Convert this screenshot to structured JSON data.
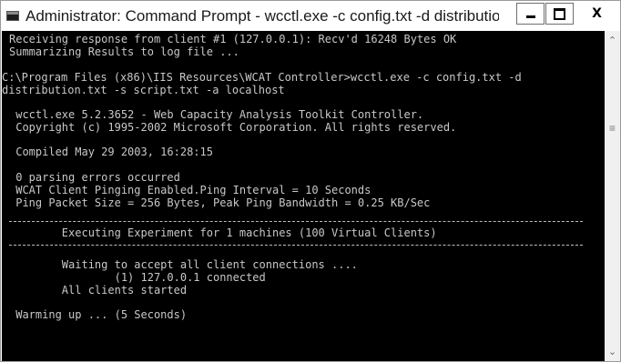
{
  "window": {
    "title": "Administrator: Command Prompt - wcctl.exe  -c config.txt -d distribution.txt -s s...",
    "controls": {
      "minimize_label": "",
      "maximize_label": "",
      "close_label": "X"
    }
  },
  "console": {
    "lines": [
      "Receiving response from client #1 (127.0.0.1): Recv'd 16248 Bytes OK",
      "Summarizing Results to log file ...",
      "",
      "C:\\Program Files (x86)\\IIS Resources\\WCAT Controller>wcctl.exe -c config.txt -d",
      "distribution.txt -s script.txt -a localhost",
      "",
      " wcctl.exe 5.2.3652 - Web Capacity Analysis Toolkit Controller.",
      " Copyright (c) 1995-2002 Microsoft Corporation. All rights reserved.",
      "",
      " Compiled May 29 2003, 16:28:15",
      "",
      " 0 parsing errors occurred",
      " WCAT Client Pinging Enabled.Ping Interval = 10 Seconds",
      " Ping Packet Size = 256 Bytes, Peak Ping Bandwidth = 0.25 KB/Sec",
      "",
      "        Executing Experiment for 1 machines (100 Virtual Clients)",
      "",
      "        Waiting to accept all client connections ....",
      "                (1) 127.0.0.1 connected",
      "        All clients started",
      "",
      " Warming up ... (5 Seconds)"
    ]
  },
  "scrollbar": {
    "up_icon": "chevron-up-icon",
    "down_icon": "chevron-down-icon",
    "thumb_icon": "grip-icon"
  },
  "colors": {
    "console_bg": "#000000",
    "console_text": "#c8c8c8",
    "titlebar_bg": "#ffffff"
  }
}
